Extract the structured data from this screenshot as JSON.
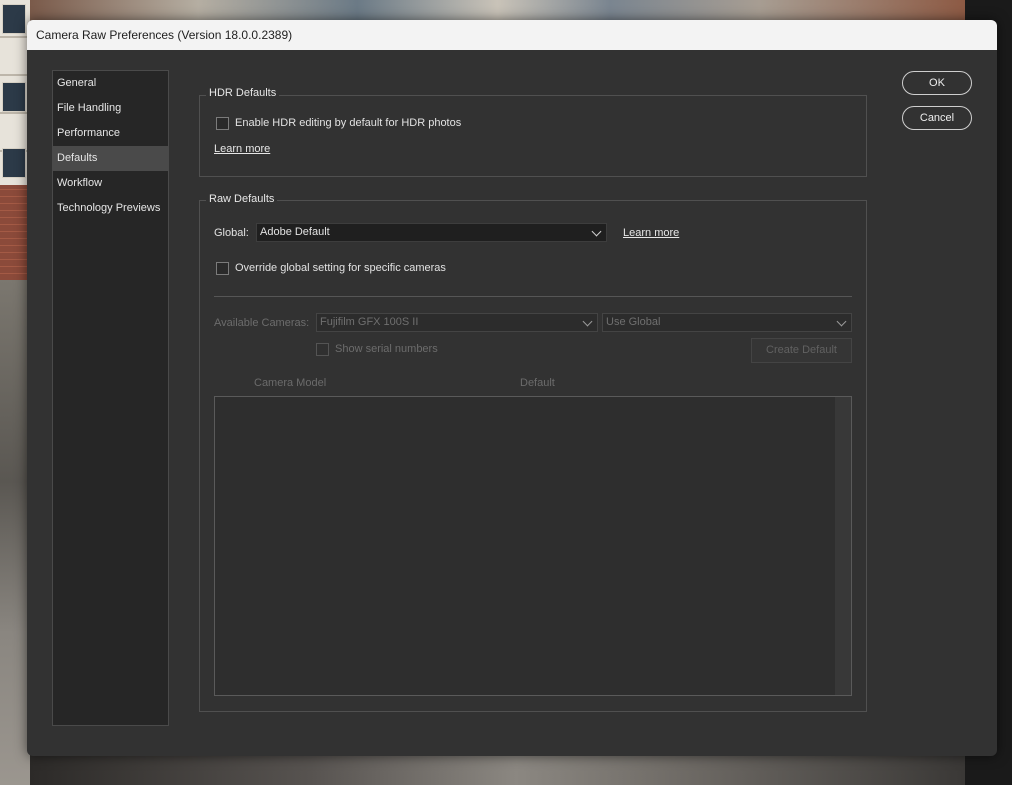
{
  "window": {
    "title": "Camera Raw Preferences  (Version 18.0.0.2389)"
  },
  "sidebar": {
    "items": [
      {
        "label": "General",
        "active": false
      },
      {
        "label": "File Handling",
        "active": false
      },
      {
        "label": "Performance",
        "active": false
      },
      {
        "label": "Defaults",
        "active": true
      },
      {
        "label": "Workflow",
        "active": false
      },
      {
        "label": "Technology Previews",
        "active": false
      }
    ]
  },
  "actions": {
    "ok_label": "OK",
    "cancel_label": "Cancel"
  },
  "hdr_defaults": {
    "title": "HDR Defaults",
    "enable_hdr_label": "Enable HDR editing by default for HDR photos",
    "enable_hdr_checked": false,
    "learn_more": "Learn more"
  },
  "raw_defaults": {
    "title": "Raw Defaults",
    "global_label": "Global:",
    "global_value": "Adobe Default",
    "learn_more": "Learn more",
    "override_label": "Override global setting for specific cameras",
    "override_checked": false,
    "available_cameras_label": "Available Cameras:",
    "camera_value": "Fujifilm GFX 100S II",
    "camera_default_value": "Use Global",
    "show_serial_label": "Show serial numbers",
    "show_serial_checked": false,
    "create_default_label": "Create Default",
    "table": {
      "columns": [
        "Camera Model",
        "Default"
      ],
      "rows": []
    }
  },
  "colors": {
    "dialog_bg": "#323232",
    "titlebar_bg": "#f3f3f3",
    "sidebar_bg": "#262626",
    "active_item_bg": "#4a4a4a"
  }
}
